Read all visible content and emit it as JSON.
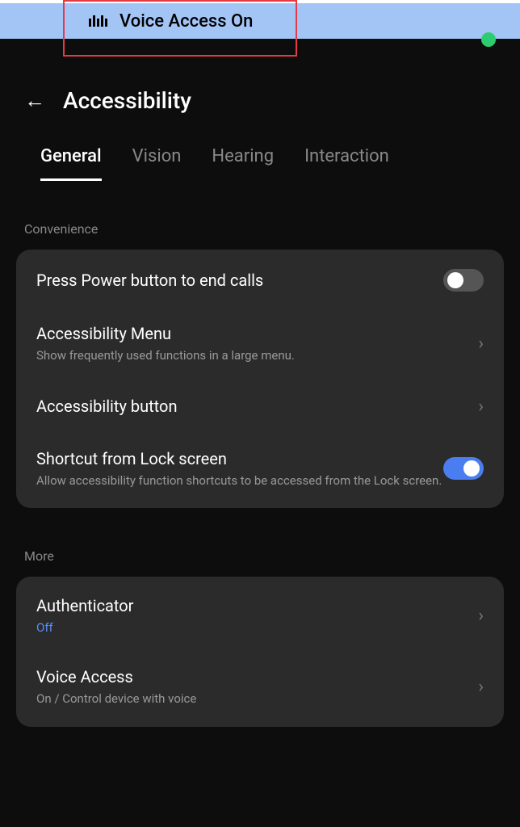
{
  "notification": {
    "label": "Voice Access On"
  },
  "header": {
    "title": "Accessibility"
  },
  "tabs": [
    {
      "label": "General",
      "active": true
    },
    {
      "label": "Vision",
      "active": false
    },
    {
      "label": "Hearing",
      "active": false
    },
    {
      "label": "Interaction",
      "active": false
    }
  ],
  "sections": {
    "convenience": {
      "label": "Convenience",
      "items": [
        {
          "title": "Press Power button to end calls",
          "subtitle": "",
          "type": "toggle",
          "toggled": false
        },
        {
          "title": "Accessibility Menu",
          "subtitle": "Show frequently used functions in a large menu.",
          "type": "nav"
        },
        {
          "title": "Accessibility button",
          "subtitle": "",
          "type": "nav"
        },
        {
          "title": "Shortcut from Lock screen",
          "subtitle": "Allow accessibility function shortcuts to be accessed from the Lock screen.",
          "type": "toggle",
          "toggled": true
        }
      ]
    },
    "more": {
      "label": "More",
      "items": [
        {
          "title": "Authenticator",
          "subtitle_blue": "Off",
          "type": "nav"
        },
        {
          "title": "Voice Access",
          "subtitle": "On / Control device with voice",
          "type": "nav"
        }
      ]
    }
  }
}
